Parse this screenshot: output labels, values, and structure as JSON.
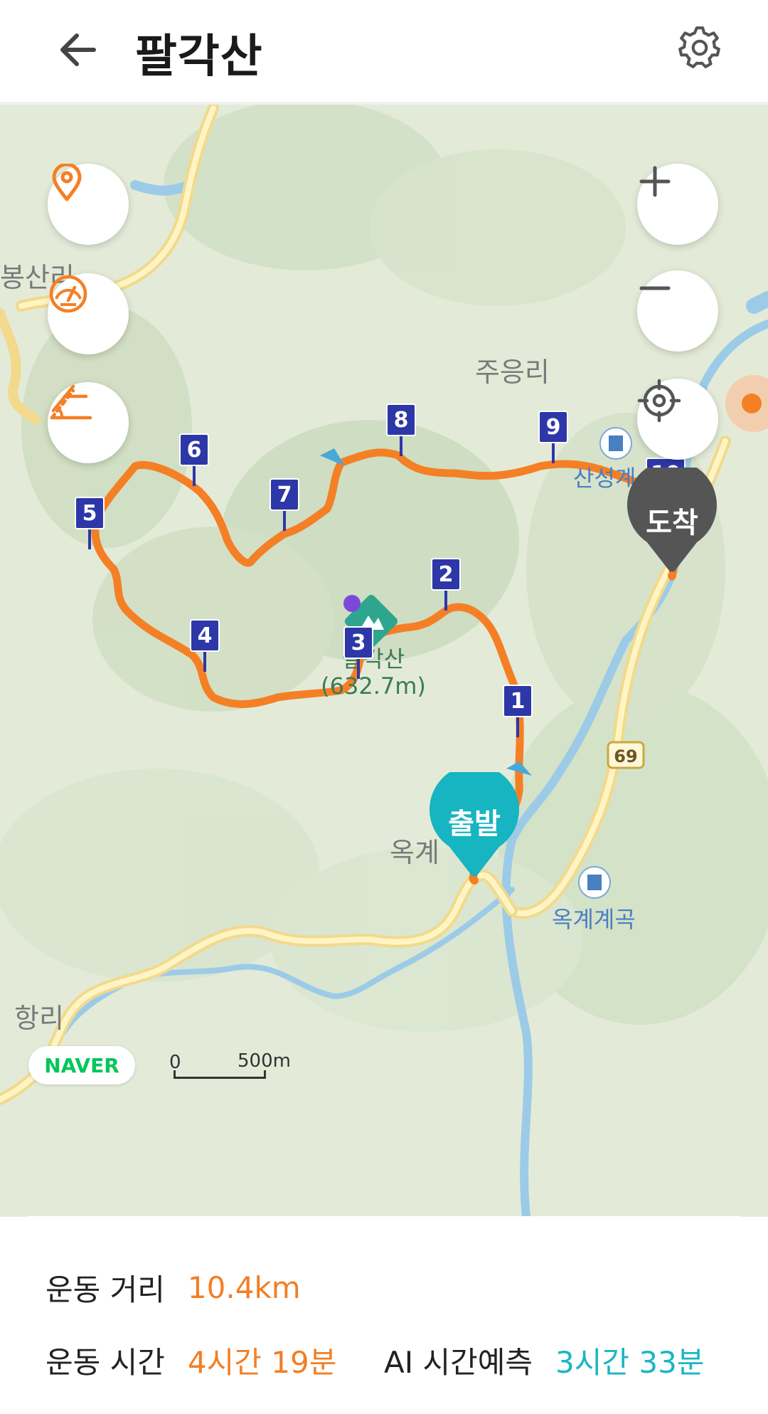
{
  "header": {
    "title": "팔각산"
  },
  "map": {
    "places": {
      "north_left": "봉산리",
      "north_center": "주응리",
      "south_left": "항리",
      "valley": "옥계",
      "valley_blue": "옥계계곡",
      "north_blue": "산성계",
      "peak_name": "팔각산",
      "peak_height": "(632.7m)"
    },
    "road_badge": "69",
    "waypoints": [
      "1",
      "2",
      "3",
      "4",
      "5",
      "6",
      "7",
      "8",
      "9",
      "10"
    ],
    "start_label": "출발",
    "end_label": "도착",
    "naver_logo": "NAVER",
    "scale_zero": "0",
    "scale_distance": "500m",
    "colors": {
      "route": "#f57f25",
      "waypoint": "#2d37a8",
      "start": "#17b4c1",
      "end": "#555555"
    }
  },
  "panel": {
    "distance_label": "운동 거리",
    "distance_value": "10.4km",
    "time_label": "운동 시간",
    "time_value": "4시간 19분",
    "ai_label": "AI 시간예측",
    "ai_value": "3시간 33분"
  }
}
